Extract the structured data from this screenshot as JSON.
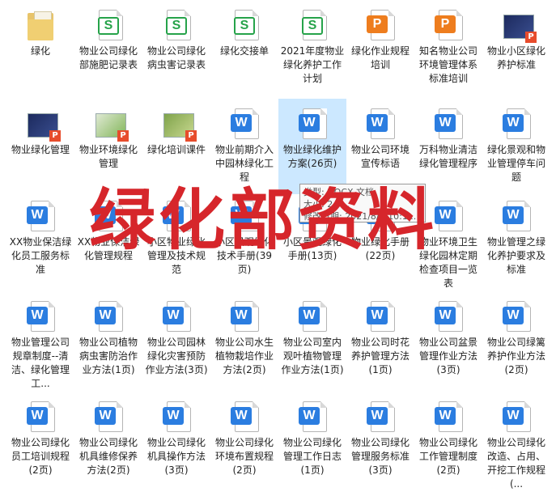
{
  "items": [
    {
      "type": "folder",
      "label": "绿化"
    },
    {
      "type": "s",
      "label": "物业公司绿化部施肥记录表"
    },
    {
      "type": "s",
      "label": "物业公司绿化病虫害记录表"
    },
    {
      "type": "s",
      "label": "绿化交接单"
    },
    {
      "type": "s",
      "label": "2021年度物业绿化养护工作计划"
    },
    {
      "type": "p",
      "label": "绿化作业规程培训"
    },
    {
      "type": "p",
      "label": "知名物业公司环境管理体系标准培训"
    },
    {
      "type": "img-navy",
      "label": "物业小区绿化养护标准"
    },
    {
      "type": "img-navy",
      "label": "物业绿化管理"
    },
    {
      "type": "img-green",
      "label": "物业环境绿化管理"
    },
    {
      "type": "img-leaf",
      "label": "绿化培训课件"
    },
    {
      "type": "w",
      "label": "物业前期介入中园林绿化工程"
    },
    {
      "type": "w",
      "label": "物业绿化维护方案(26页)",
      "selected": true
    },
    {
      "type": "w",
      "label": "物业公司环境宣传标语"
    },
    {
      "type": "w",
      "label": "万科物业清洁绿化管理程序"
    },
    {
      "type": "w",
      "label": "绿化景观和物业管理停车问题"
    },
    {
      "type": "w",
      "label": "XX物业保洁绿化员工服务标准"
    },
    {
      "type": "w",
      "label": "XX物业保洁绿化管理规程"
    },
    {
      "type": "w",
      "label": "小区物业绿化管理及技术规范"
    },
    {
      "type": "w",
      "label": "小区景观绿化技术手册(39页)"
    },
    {
      "type": "w",
      "label": "小区景观绿化手册(13页)"
    },
    {
      "type": "w",
      "label": "物业绿化手册(22页)"
    },
    {
      "type": "w",
      "label": "物业环境卫生绿化园林定期检查项目一览表"
    },
    {
      "type": "w",
      "label": "物业管理之绿化养护要求及标准"
    },
    {
      "type": "w",
      "label": "物业管理公司规章制度--清洁、绿化管理工..."
    },
    {
      "type": "w",
      "label": "物业公司植物病虫害防治作业方法(1页)"
    },
    {
      "type": "w",
      "label": "物业公司园林绿化灾害预防作业方法(3页)"
    },
    {
      "type": "w",
      "label": "物业公司水生植物栽培作业方法(2页)"
    },
    {
      "type": "w",
      "label": "物业公司室内观叶植物管理作业方法(1页)"
    },
    {
      "type": "w",
      "label": "物业公司时花养护管理方法(1页)"
    },
    {
      "type": "w",
      "label": "物业公司盆景管理作业方法(3页)"
    },
    {
      "type": "w",
      "label": "物业公司绿篱养护作业方法(2页)"
    },
    {
      "type": "w",
      "label": "物业公司绿化员工培训规程(2页)"
    },
    {
      "type": "w",
      "label": "物业公司绿化机具维修保养方法(2页)"
    },
    {
      "type": "w",
      "label": "物业公司绿化机具操作方法(3页)"
    },
    {
      "type": "w",
      "label": "物业公司绿化环境布置规程(2页)"
    },
    {
      "type": "w",
      "label": "物业公司绿化管理工作日志(1页)"
    },
    {
      "type": "w",
      "label": "物业公司绿化管理服务标准(3页)"
    },
    {
      "type": "w",
      "label": "物业公司绿化工作管理制度(2页)"
    },
    {
      "type": "w",
      "label": "物业公司绿化改造、占用、开挖工作规程(..."
    }
  ],
  "banner": {
    "text": "绿化部资料"
  },
  "tooltip": {
    "type": "类型: DOCX 文档",
    "size": "大小: 2.9...",
    "modified": "修改日期: 2021/8/8 10:1..."
  },
  "colors": {
    "selection": "#cce8ff",
    "banner": "#d6262b",
    "word": "#2b7de0",
    "sheet": "#26a34a",
    "ppt": "#ee7d1e"
  }
}
